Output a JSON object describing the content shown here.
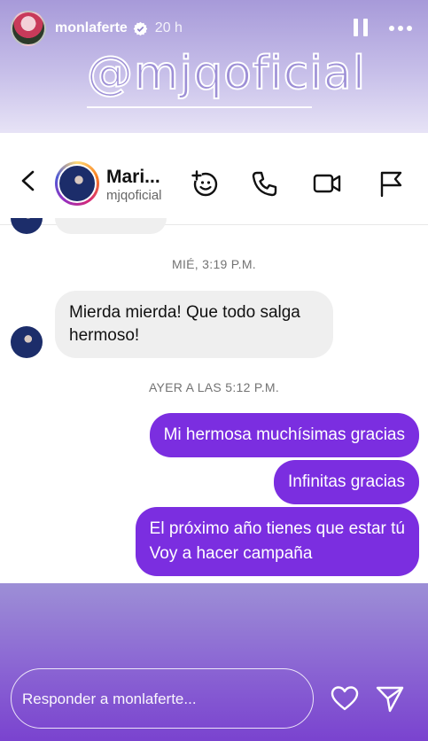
{
  "story": {
    "username": "monlaferte",
    "time": "20 h",
    "mention": "@mjqoficial"
  },
  "dm": {
    "contact_name": "Mari...",
    "contact_handle": "mjqoficial",
    "messages": [
      {
        "type": "timestamp",
        "text": "MIÉ, 3:19 P.M."
      },
      {
        "type": "incoming",
        "text": "Mierda mierda! Que todo salga hermoso!"
      },
      {
        "type": "timestamp",
        "text": "AYER A LAS 5:12 P.M."
      },
      {
        "type": "outgoing",
        "text": "Mi hermosa muchísimas gracias"
      },
      {
        "type": "outgoing",
        "text": "Infinitas gracias"
      },
      {
        "type": "outgoing",
        "text": "El próximo año tienes que estar tú Voy a hacer campaña",
        "line1": "El próximo año tienes que estar tú",
        "line2": "Voy a hacer campaña"
      }
    ]
  },
  "reply": {
    "placeholder": "Responder a monlaferte..."
  },
  "icons": {
    "verified": "verified-badge-icon",
    "pause": "pause-icon",
    "more": "more-icon",
    "back": "back-arrow-icon",
    "emoji": "emoji-add-icon",
    "phone": "phone-icon",
    "video": "video-icon",
    "flag": "flag-icon",
    "heart": "heart-icon",
    "send": "send-icon"
  },
  "colors": {
    "outgoing_bubble": "#7b2ee0",
    "incoming_bubble": "#efefef",
    "verified": "#3897f0"
  }
}
